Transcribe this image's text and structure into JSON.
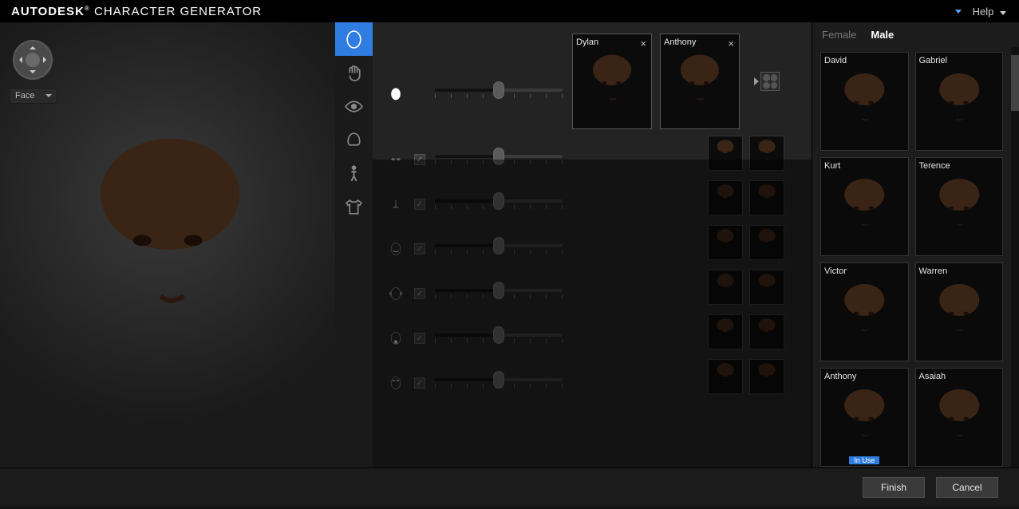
{
  "header": {
    "brand_a": "AUTODESK",
    "brand_b": "CHARACTER GENERATOR",
    "help_label": "Help"
  },
  "viewport": {
    "view_mode": "Face"
  },
  "toolstrip": {
    "items": [
      {
        "name": "face",
        "active": true
      },
      {
        "name": "body",
        "active": false
      },
      {
        "name": "eyes",
        "active": false
      },
      {
        "name": "hair",
        "active": false
      },
      {
        "name": "height",
        "active": false
      },
      {
        "name": "clothing",
        "active": false
      }
    ]
  },
  "editor": {
    "main_slider": {
      "value": 50
    },
    "selected_faces": [
      {
        "name": "Dylan"
      },
      {
        "name": "Anthony"
      }
    ],
    "feature_rows": [
      {
        "icon": "eyes",
        "enabled": true,
        "value": 50
      },
      {
        "icon": "nose",
        "enabled": true,
        "value": 50
      },
      {
        "icon": "mouth",
        "enabled": true,
        "value": 50
      },
      {
        "icon": "ears",
        "enabled": true,
        "value": 50
      },
      {
        "icon": "jaw",
        "enabled": true,
        "value": 50
      },
      {
        "icon": "brow",
        "enabled": true,
        "value": 50
      }
    ]
  },
  "library": {
    "tabs": {
      "female": "Female",
      "male": "Male",
      "active": "male"
    },
    "items": [
      {
        "name": "David"
      },
      {
        "name": "Gabriel"
      },
      {
        "name": "Kurt"
      },
      {
        "name": "Terence"
      },
      {
        "name": "Victor"
      },
      {
        "name": "Warren"
      },
      {
        "name": "Anthony",
        "badge": "In Use"
      },
      {
        "name": "Asaiah"
      }
    ]
  },
  "footer": {
    "finish": "Finish",
    "cancel": "Cancel"
  }
}
